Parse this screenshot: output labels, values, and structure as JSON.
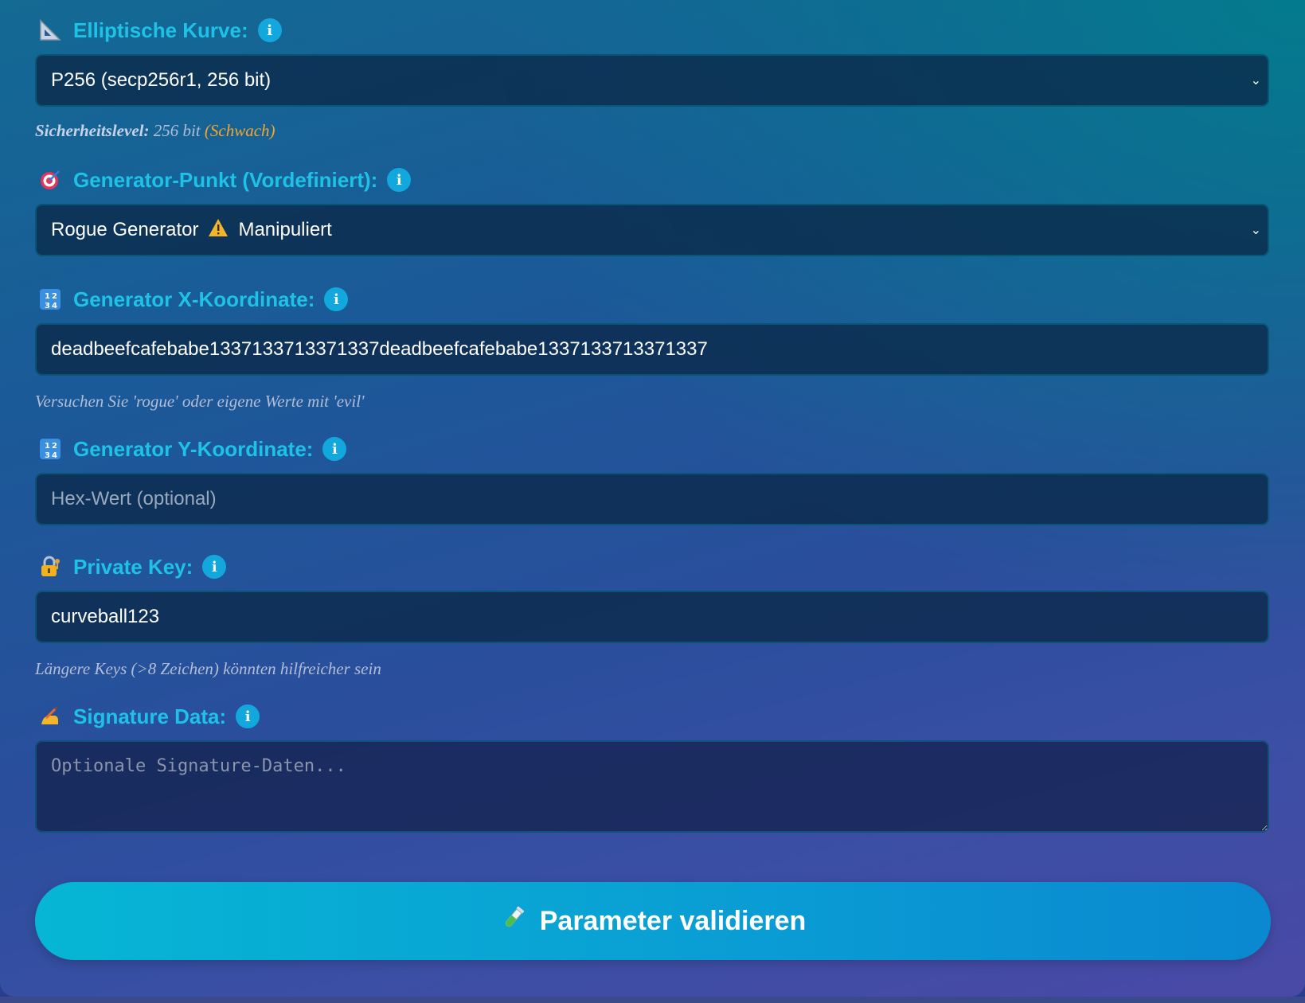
{
  "curve": {
    "label": "Elliptische Kurve:",
    "icon": "triangle-ruler-icon",
    "selected": "P256 (secp256r1, 256 bit)"
  },
  "security": {
    "label": "Sicherheitslevel:",
    "value": "256 bit",
    "rating": "(Schwach)"
  },
  "generator_point": {
    "label": "Generator-Punkt (Vordefiniert):",
    "icon": "target-icon",
    "selected_name": "Rogue Generator",
    "selected_tag": "Manipuliert"
  },
  "x_coord": {
    "label": "Generator X-Koordinate:",
    "icon": "numbers-icon",
    "value": "deadbeefcafebabe1337133713371337deadbeefcafebabe1337133713371337",
    "hint": "Versuchen Sie 'rogue' oder eigene Werte mit 'evil'"
  },
  "y_coord": {
    "label": "Generator Y-Koordinate:",
    "icon": "numbers-icon",
    "placeholder": "Hex-Wert (optional)"
  },
  "private_key": {
    "label": "Private Key:",
    "icon": "lock-key-icon",
    "value": "curveball123",
    "hint": "Längere Keys (>8 Zeichen) könnten hilfreicher sein"
  },
  "signature": {
    "label": "Signature Data:",
    "icon": "writing-hand-icon",
    "placeholder": "Optionale Signature-Daten..."
  },
  "submit": {
    "label": "Parameter validieren",
    "icon": "test-tube-icon"
  },
  "colors": {
    "label": "#1ec2e6",
    "info": "#13a8dd",
    "weak": "#f5a62b",
    "button_start": "#06b6d4",
    "button_end": "#0a88d0"
  }
}
